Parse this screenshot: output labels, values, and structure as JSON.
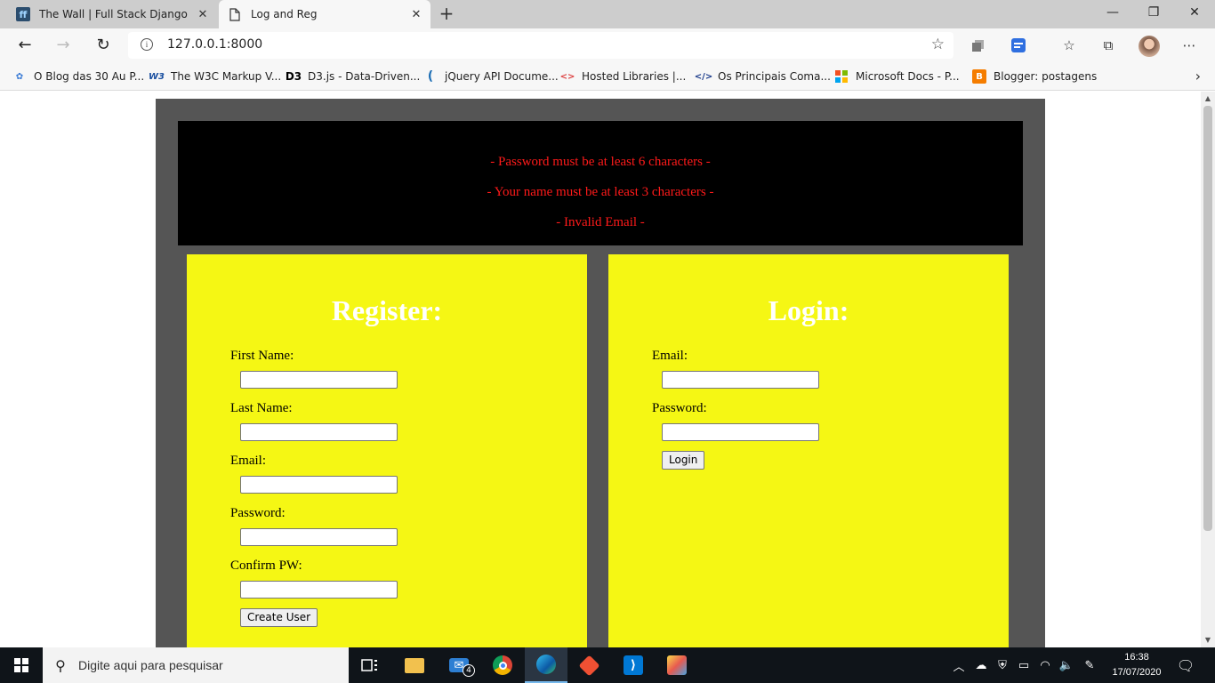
{
  "browser": {
    "tabs": [
      {
        "title": "The Wall | Full Stack Django",
        "favicon": "django-icon",
        "active": false
      },
      {
        "title": "Log and Reg",
        "favicon": "page-icon",
        "active": true
      }
    ],
    "url": "127.0.0.1:8000",
    "bookmarks": [
      {
        "label": "O Blog das 30 Au P...",
        "icon": "blog-icon"
      },
      {
        "label": "The W3C Markup V...",
        "icon": "w3c-icon"
      },
      {
        "label": "D3.js - Data-Driven...",
        "icon": "d3-icon"
      },
      {
        "label": "jQuery API Docume...",
        "icon": "jquery-icon"
      },
      {
        "label": "Hosted Libraries  |...",
        "icon": "code-arrows-icon"
      },
      {
        "label": "Os Principais Coma...",
        "icon": "code-icon"
      },
      {
        "label": "Microsoft Docs - P...",
        "icon": "microsoft-icon"
      },
      {
        "label": "Blogger: postagens",
        "icon": "blogger-icon"
      }
    ]
  },
  "page": {
    "errors": [
      "- Password must be at least 6 characters -",
      "- Your name must be at least 3 characters -",
      "- Invalid Email -"
    ],
    "register": {
      "heading": "Register:",
      "fields": [
        {
          "label": "First Name:",
          "value": ""
        },
        {
          "label": "Last Name:",
          "value": ""
        },
        {
          "label": "Email:",
          "value": ""
        },
        {
          "label": "Password:",
          "value": ""
        },
        {
          "label": "Confirm PW:",
          "value": ""
        }
      ],
      "submit": "Create User"
    },
    "login": {
      "heading": "Login:",
      "fields": [
        {
          "label": "Email:",
          "value": ""
        },
        {
          "label": "Password:",
          "value": ""
        }
      ],
      "submit": "Login"
    },
    "colors": {
      "wrapper": "#555555",
      "error_box": "#000000",
      "error_text": "#ff1a1a",
      "panel": "#f5f714",
      "heading": "#ffffff"
    }
  },
  "taskbar": {
    "search_placeholder": "Digite aqui para pesquisar",
    "mail_badge": "4",
    "time": "16:38",
    "date": "17/07/2020"
  }
}
